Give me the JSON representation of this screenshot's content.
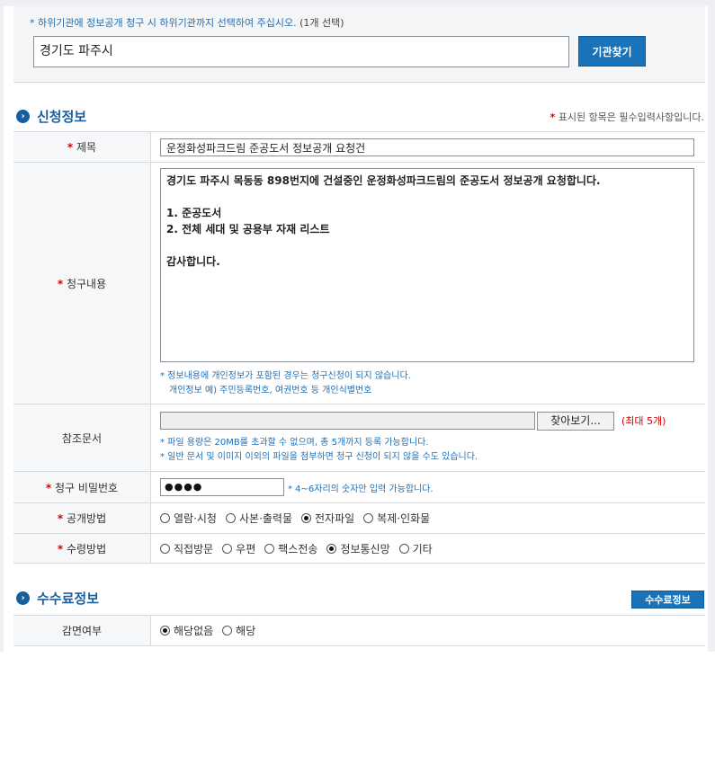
{
  "agency": {
    "note": "* 하위기관에 정보공개 청구 시 하위기관까지 선택하여 주십시오.",
    "note_paren": "(1개 선택)",
    "input_value": "경기도 파주시",
    "find_button": "기관찾기"
  },
  "application": {
    "section_title": "신청정보",
    "required_legend": "표시된 항목은 필수입력사항입니다.",
    "title_label": "제목",
    "title_value": "운정화성파크드림 준공도서 정보공개 요청건",
    "content_label": "청구내용",
    "content_value": "경기도 파주시 목동동 898번지에 건설중인 운정화성파크드림의 준공도서 정보공개 요청합니다.\n\n1. 준공도서\n2. 전체 세대 및 공용부 자재 리스트\n\n감사합니다.",
    "content_note1": "* 정보내용에 개인정보가 포함된 경우는 청구신청이 되지 않습니다.",
    "content_note2": "개인정보 예) 주민등록번호, 여권번호 등 개인식별번호",
    "ref_label": "참조문서",
    "browse_button": "찾아보기...",
    "max_note": "(최대 5개)",
    "ref_note1": "* 파일 용량은 20MB를 초과할 수 없으며, 총 5개까지 등록 가능합니다.",
    "ref_note2": "* 일반 문서 및 이미지 이외의 파일을 첨부하면 청구 신청이 되지 않을 수도 있습니다.",
    "password_label": "청구 비밀번호",
    "password_value": "●●●●",
    "password_note": "* 4~6자리의 숫자만 입력 가능합니다.",
    "disclosure_label": "공개방법",
    "disclosure_options": [
      "열람·시청",
      "사본·출력물",
      "전자파일",
      "복제·인화물"
    ],
    "disclosure_selected": "전자파일",
    "receive_label": "수령방법",
    "receive_options": [
      "직접방문",
      "우편",
      "팩스전송",
      "정보통신망",
      "기타"
    ],
    "receive_selected": "정보통신망"
  },
  "fee": {
    "section_title": "수수료정보",
    "fee_button": "수수료정보",
    "exempt_label": "감면여부",
    "exempt_options": [
      "해당없음",
      "해당"
    ],
    "exempt_selected": "해당없음"
  },
  "colors": {
    "accent": "#1a73b8",
    "note_blue": "#1d6fb8",
    "required_red": "#d40000"
  }
}
